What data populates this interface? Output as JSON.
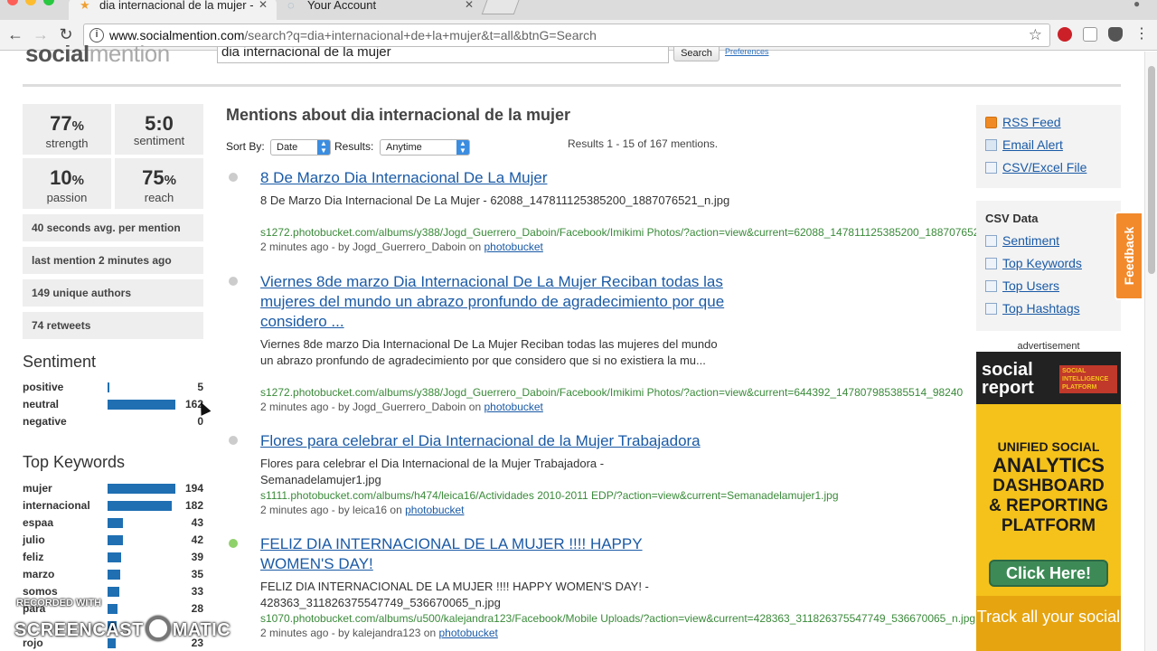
{
  "browser": {
    "tabs": [
      {
        "title": "dia internacional de la mujer -",
        "icon": "star-icon"
      },
      {
        "title": "Your Account",
        "icon": "globe-icon"
      }
    ],
    "url_domain": "www.socialmention.com",
    "url_path": "/search?q=dia+internacional+de+la+mujer&t=all&btnG=Search"
  },
  "header": {
    "logo_bold": "social",
    "logo_light": "mention",
    "search_value": "dia internacional de la mujer",
    "search_button": "Search",
    "preferences": "Preferences"
  },
  "stats": {
    "strength": {
      "value": "77",
      "unit": "%",
      "label": "strength"
    },
    "sentiment": {
      "value": "5:0",
      "label": "sentiment"
    },
    "passion": {
      "value": "10",
      "unit": "%",
      "label": "passion"
    },
    "reach": {
      "value": "75",
      "unit": "%",
      "label": "reach"
    },
    "avg_per_mention": "40 seconds avg. per mention",
    "last_mention": "last mention 2 minutes ago",
    "unique_authors": "149 unique authors",
    "retweets": "74 retweets"
  },
  "sentiment": {
    "heading": "Sentiment",
    "rows": [
      {
        "name": "positive",
        "value": "5",
        "fraction": 0.03
      },
      {
        "name": "neutral",
        "value": "162",
        "fraction": 1.0
      },
      {
        "name": "negative",
        "value": "0",
        "fraction": 0.0
      }
    ]
  },
  "keywords": {
    "heading": "Top Keywords",
    "rows": [
      {
        "name": "mujer",
        "value": "194",
        "fraction": 1.0
      },
      {
        "name": "internacional",
        "value": "182",
        "fraction": 0.94
      },
      {
        "name": "espaa",
        "value": "43",
        "fraction": 0.22
      },
      {
        "name": "julio",
        "value": "42",
        "fraction": 0.22
      },
      {
        "name": "feliz",
        "value": "39",
        "fraction": 0.2
      },
      {
        "name": "marzo",
        "value": "35",
        "fraction": 0.18
      },
      {
        "name": "somos",
        "value": "33",
        "fraction": 0.17
      },
      {
        "name": "para",
        "value": "28",
        "fraction": 0.14
      },
      {
        "name": "",
        "value": "",
        "fraction": 0.13
      },
      {
        "name": "rojo",
        "value": "23",
        "fraction": 0.12
      }
    ]
  },
  "main": {
    "heading": "Mentions about dia internacional de la mujer",
    "sort_label": "Sort By:",
    "sort_value": "Date",
    "results_label": "Results:",
    "results_value": "Anytime",
    "count": "Results 1 - 15 of 167 mentions.",
    "results": [
      {
        "title": "8 De Marzo Dia Internacional De La Mujer",
        "desc": "8 De Marzo Dia Internacional De La Mujer - 62088_147811125385200_1887076521_n.jpg",
        "src": "s1272.photobucket.com/albums/y388/Jogd_Guerrero_Daboin/Facebook/Imikimi Photos/?action=view&current=62088_147811125385200_1887076521_n.jpg",
        "meta_prefix": "2 minutes ago - by Jogd_Guerrero_Daboin on ",
        "site": "photobucket",
        "dot": "grey"
      },
      {
        "title": "Viernes 8de marzo Dia Internacional De La Mujer Reciban todas las mujeres del mundo un abrazo pronfundo de agradecimiento por que considero ...",
        "desc": "Viernes 8de marzo Dia Internacional De La Mujer Reciban todas las mujeres del mundo un abrazo pronfundo de agradecimiento por que considero que si no existiera la mu...",
        "src": "s1272.photobucket.com/albums/y388/Jogd_Guerrero_Daboin/Facebook/Imikimi Photos/?action=view&current=644392_147807985385514_98240",
        "meta_prefix": "2 minutes ago - by Jogd_Guerrero_Daboin on ",
        "site": "photobucket",
        "dot": "grey"
      },
      {
        "title": "Flores para celebrar el Dia Internacional de la Mujer Trabajadora",
        "desc": "Flores para celebrar el Dia Internacional de la Mujer Trabajadora - Semanadelamujer1.jpg",
        "src": "s1111.photobucket.com/albums/h474/leica16/Actividades 2010-2011 EDP/?action=view&current=Semanadelamujer1.jpg",
        "meta_prefix": "2 minutes ago - by leica16 on ",
        "site": "photobucket",
        "dot": "grey"
      },
      {
        "title": "FELIZ DIA INTERNACIONAL DE LA MUJER !!!! HAPPY WOMEN'S DAY!",
        "desc": "FELIZ DIA INTERNACIONAL DE LA MUJER !!!! HAPPY WOMEN'S DAY! - 428363_311826375547749_536670065_n.jpg",
        "src": "s1070.photobucket.com/albums/u500/kalejandra123/Facebook/Mobile Uploads/?action=view&current=428363_311826375547749_536670065_n.jpg",
        "meta_prefix": "2 minutes ago - by kalejandra123 on ",
        "site": "photobucket",
        "dot": "green"
      }
    ]
  },
  "right": {
    "links": [
      "RSS Feed",
      "Email Alert",
      "CSV/Excel File"
    ],
    "csv_heading": "CSV Data",
    "csv_links": [
      "Sentiment",
      "Top Keywords",
      "Top Users",
      "Top Hashtags"
    ],
    "feedback": "Feedback",
    "ad_label": "advertisement",
    "ad": {
      "brand_line1": "social",
      "brand_line2": "report",
      "tag": "SOCIAL INTELLIGENCE PLATFORM",
      "headline": [
        "UNIFIED SOCIAL",
        "ANALYTICS",
        "DASHBOARD",
        "& REPORTING",
        "PLATFORM"
      ],
      "button": "Click Here!",
      "bottom": "Track all your social"
    }
  },
  "watermark": {
    "line1": "RECORDED WITH",
    "line2a": "SCREENCAST",
    "line2b": "MATIC"
  }
}
